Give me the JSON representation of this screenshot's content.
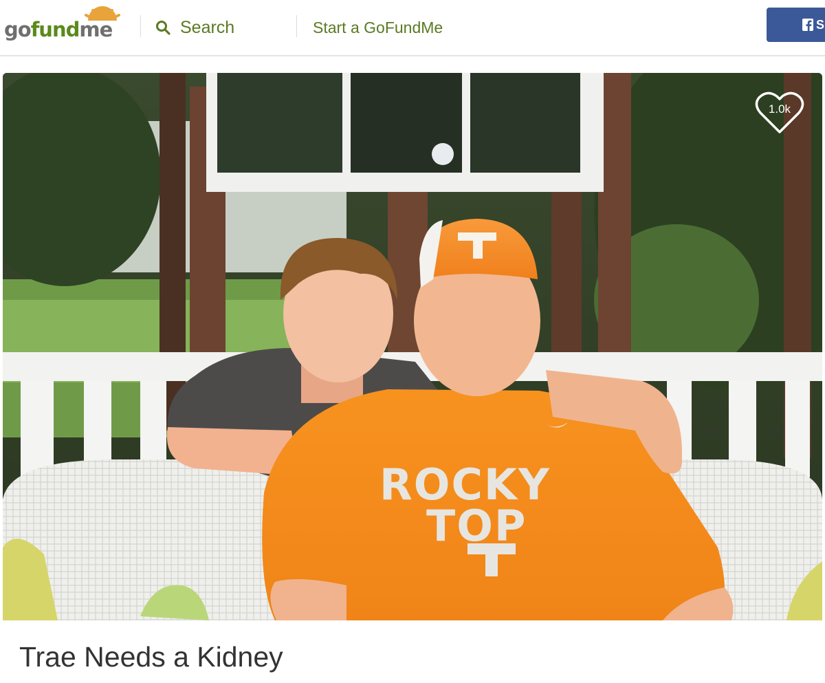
{
  "header": {
    "logo_text": "gofundme",
    "search_label": "Search",
    "start_label": "Start a GoFundMe",
    "facebook_label": "S"
  },
  "campaign": {
    "likes": "1.0k",
    "title": "Trae Needs a Kidney"
  },
  "colors": {
    "brand_green": "#5a8a1b",
    "logo_sun": "#e8a33a",
    "facebook": "#3b5998",
    "shirt_orange": "#f58d1f"
  },
  "icons": {
    "search": "search-icon",
    "heart": "heart-icon",
    "facebook": "facebook-icon"
  }
}
